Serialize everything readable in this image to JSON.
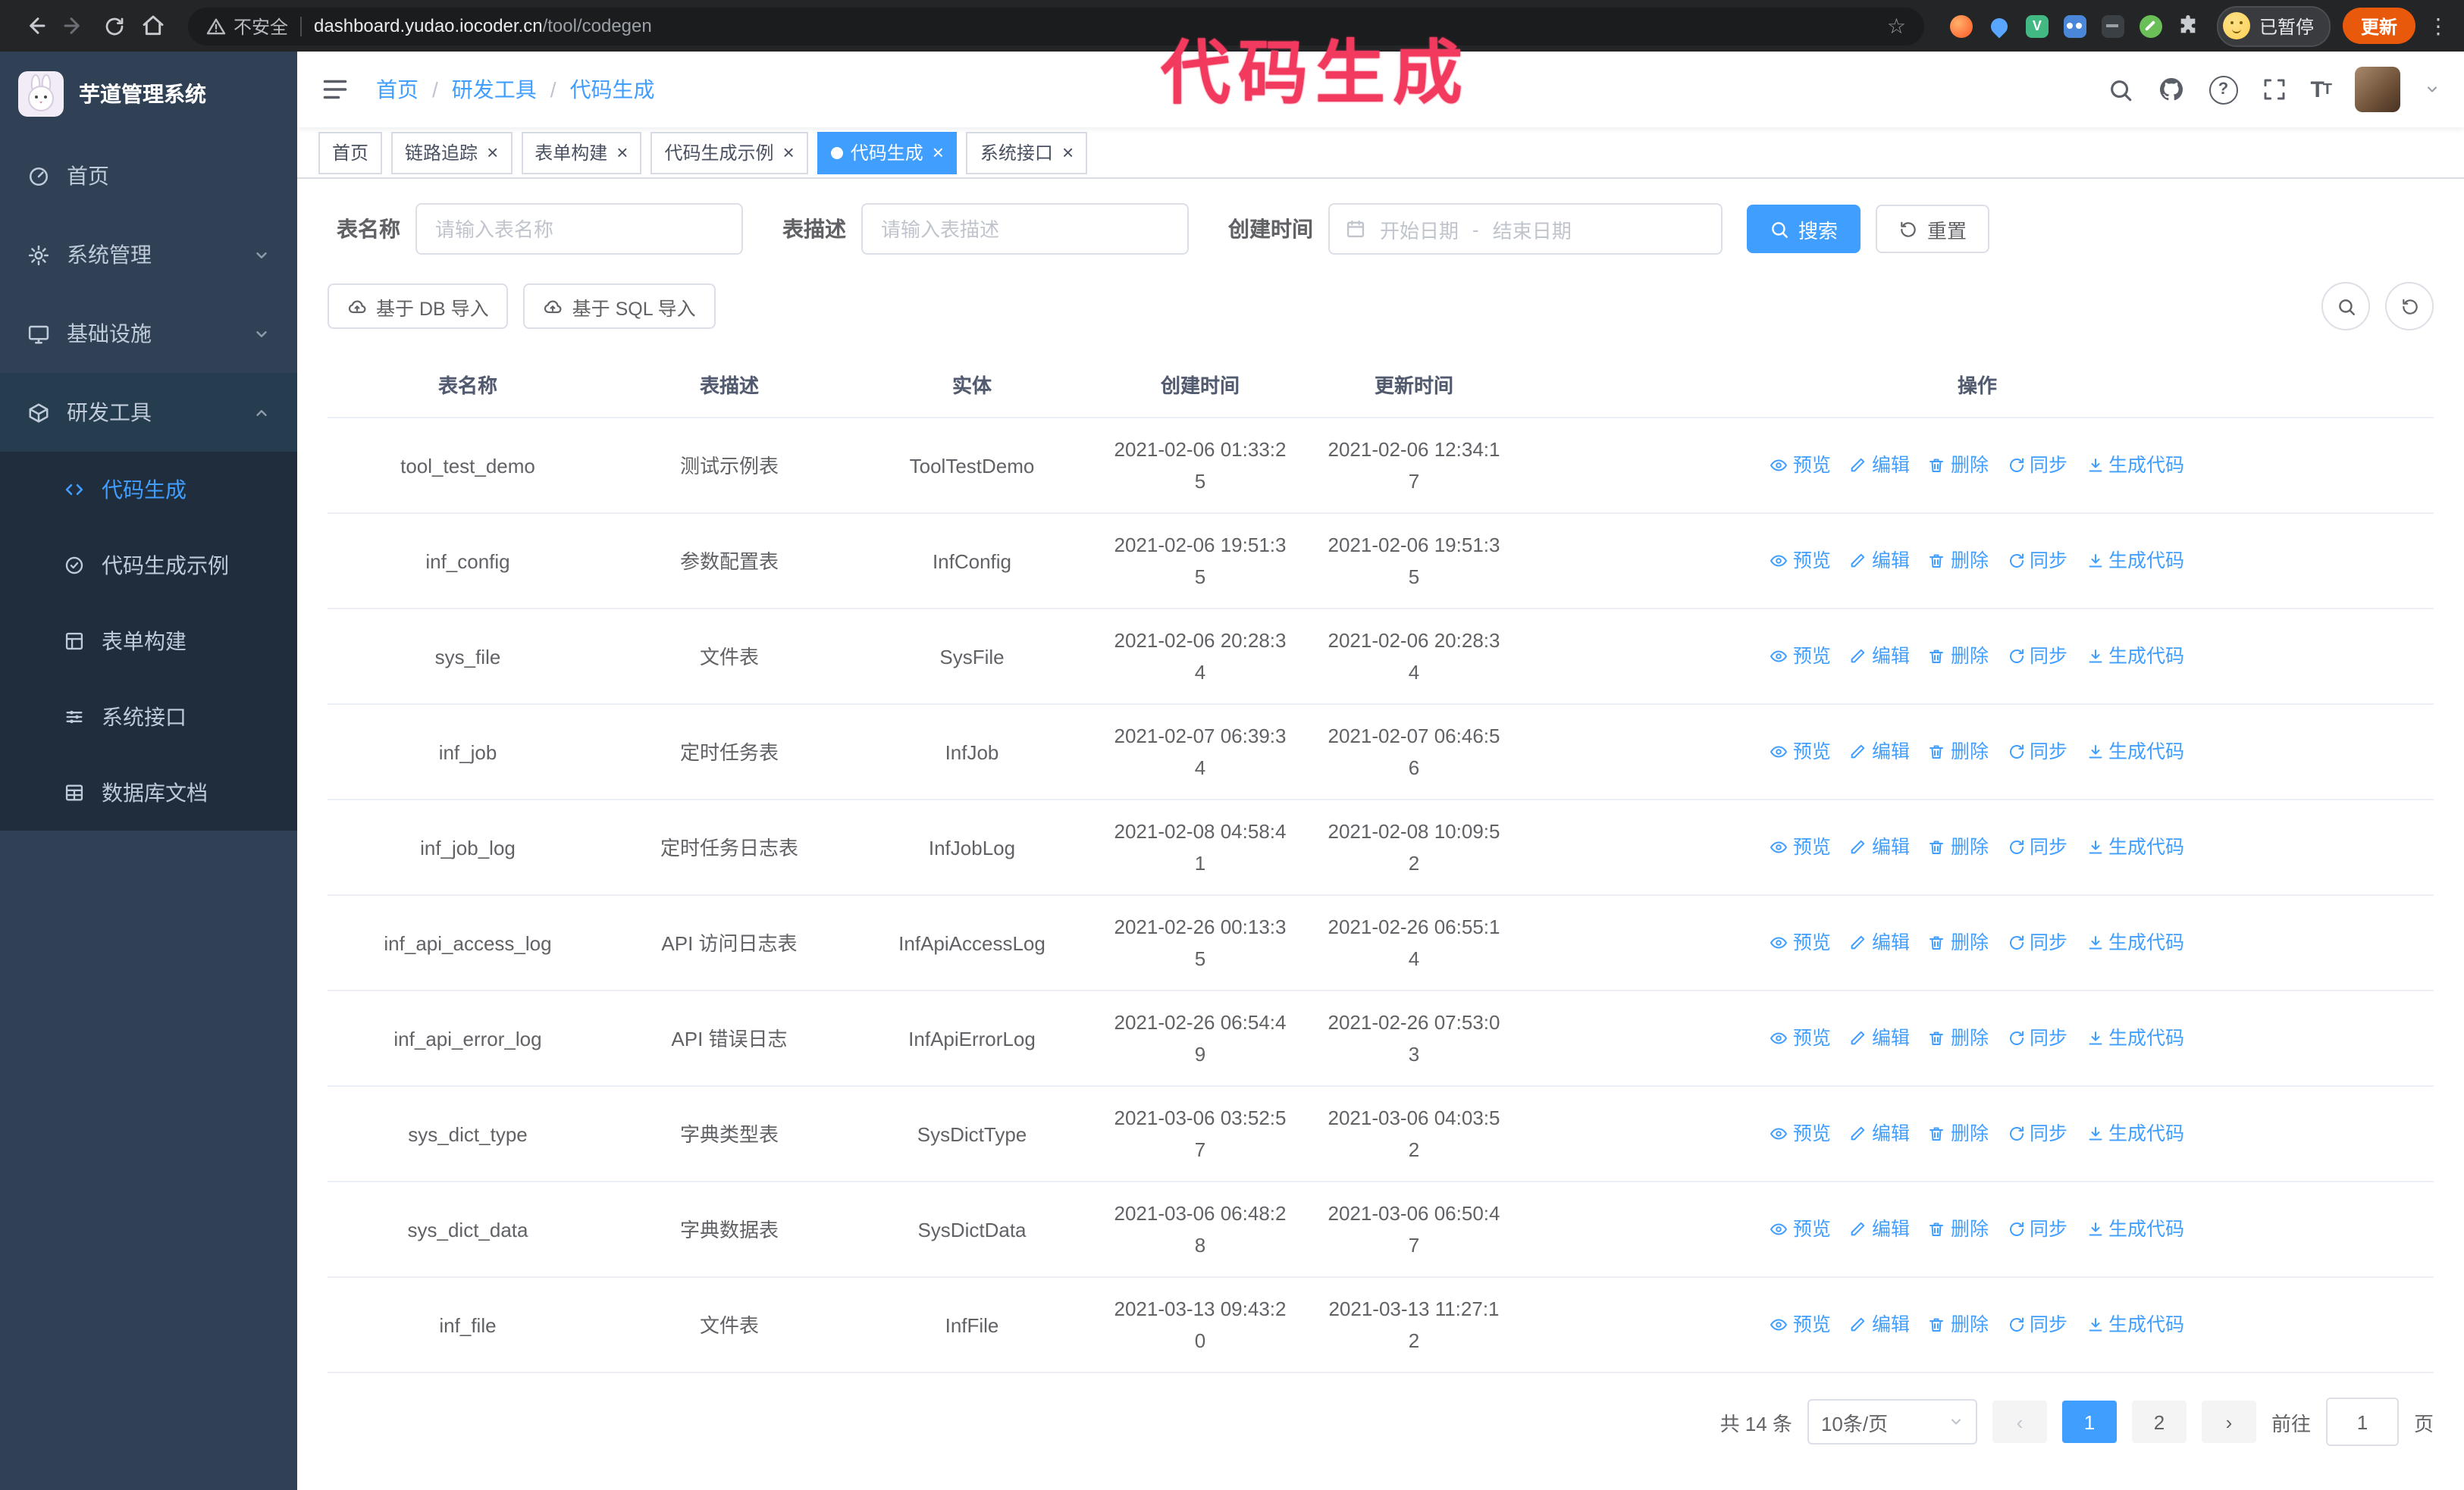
{
  "colors": {
    "accent": "#409eff",
    "annotation": "#f23a5f",
    "update_button": "#e8590c",
    "sidebar_bg": "#304156",
    "submenu_bg": "#1f2d3d"
  },
  "annotation": {
    "text": "代码生成"
  },
  "browser": {
    "nav_icons": [
      "back-icon",
      "forward-icon",
      "reload-icon",
      "home-icon"
    ],
    "security_label": "不安全",
    "url_domain": "dashboard.yudao.iocoder.cn",
    "url_path": "/tool/codegen",
    "extension_icons": [
      "fox-extension-icon",
      "drop-extension-icon",
      "vue-extension-icon",
      "users-extension-icon",
      "dark-extension-icon",
      "leaf-extension-icon",
      "puzzle-icon"
    ],
    "profile_badge": "已暂停",
    "update_label": "更新"
  },
  "sidebar": {
    "logo_title": "芋道管理系统",
    "items": [
      {
        "label": "首页",
        "icon": "dashboard-icon",
        "expandable": false
      },
      {
        "label": "系统管理",
        "icon": "gear-icon",
        "expandable": true
      },
      {
        "label": "基础设施",
        "icon": "monitor-icon",
        "expandable": true
      },
      {
        "label": "研发工具",
        "icon": "toolbox-icon",
        "expandable": true,
        "expanded": true
      }
    ],
    "submenu": [
      {
        "label": "代码生成",
        "icon": "code-icon",
        "active": true
      },
      {
        "label": "代码生成示例",
        "icon": "badge-check-icon",
        "active": false
      },
      {
        "label": "表单构建",
        "icon": "form-icon",
        "active": false
      },
      {
        "label": "系统接口",
        "icon": "sliders-icon",
        "active": false
      },
      {
        "label": "数据库文档",
        "icon": "table-icon",
        "active": false
      }
    ]
  },
  "header": {
    "breadcrumb": [
      "首页",
      "研发工具",
      "代码生成"
    ],
    "separator": "/"
  },
  "tabs": [
    {
      "label": "首页",
      "closable": false,
      "active": false
    },
    {
      "label": "链路追踪",
      "closable": true,
      "active": false
    },
    {
      "label": "表单构建",
      "closable": true,
      "active": false
    },
    {
      "label": "代码生成示例",
      "closable": true,
      "active": false
    },
    {
      "label": "代码生成",
      "closable": true,
      "active": true
    },
    {
      "label": "系统接口",
      "closable": true,
      "active": false
    }
  ],
  "filters": {
    "table_name_label": "表名称",
    "table_name_placeholder": "请输入表名称",
    "table_desc_label": "表描述",
    "table_desc_placeholder": "请输入表描述",
    "create_time_label": "创建时间",
    "date_start_placeholder": "开始日期",
    "date_separator": "-",
    "date_end_placeholder": "结束日期",
    "search_label": "搜索",
    "reset_label": "重置"
  },
  "toolbar": {
    "import_db_label": "基于 DB 导入",
    "import_sql_label": "基于 SQL 导入",
    "icons": [
      "search-icon",
      "refresh-icon"
    ]
  },
  "table": {
    "columns": [
      "表名称",
      "表描述",
      "实体",
      "创建时间",
      "更新时间",
      "操作"
    ],
    "actions": [
      {
        "label": "预览",
        "icon": "eye-icon"
      },
      {
        "label": "编辑",
        "icon": "edit-icon"
      },
      {
        "label": "删除",
        "icon": "trash-icon"
      },
      {
        "label": "同步",
        "icon": "sync-icon"
      },
      {
        "label": "生成代码",
        "icon": "download-icon"
      }
    ],
    "rows": [
      {
        "name": "tool_test_demo",
        "desc": "测试示例表",
        "entity": "ToolTestDemo",
        "created": "2021-02-06 01:33:25",
        "updated": "2021-02-06 12:34:17"
      },
      {
        "name": "inf_config",
        "desc": "参数配置表",
        "entity": "InfConfig",
        "created": "2021-02-06 19:51:35",
        "updated": "2021-02-06 19:51:35"
      },
      {
        "name": "sys_file",
        "desc": "文件表",
        "entity": "SysFile",
        "created": "2021-02-06 20:28:34",
        "updated": "2021-02-06 20:28:34"
      },
      {
        "name": "inf_job",
        "desc": "定时任务表",
        "entity": "InfJob",
        "created": "2021-02-07 06:39:34",
        "updated": "2021-02-07 06:46:56"
      },
      {
        "name": "inf_job_log",
        "desc": "定时任务日志表",
        "entity": "InfJobLog",
        "created": "2021-02-08 04:58:41",
        "updated": "2021-02-08 10:09:52"
      },
      {
        "name": "inf_api_access_log",
        "desc": "API 访问日志表",
        "entity": "InfApiAccessLog",
        "created": "2021-02-26 00:13:35",
        "updated": "2021-02-26 06:55:14"
      },
      {
        "name": "inf_api_error_log",
        "desc": "API 错误日志",
        "entity": "InfApiErrorLog",
        "created": "2021-02-26 06:54:49",
        "updated": "2021-02-26 07:53:03"
      },
      {
        "name": "sys_dict_type",
        "desc": "字典类型表",
        "entity": "SysDictType",
        "created": "2021-03-06 03:52:57",
        "updated": "2021-03-06 04:03:52"
      },
      {
        "name": "sys_dict_data",
        "desc": "字典数据表",
        "entity": "SysDictData",
        "created": "2021-03-06 06:48:28",
        "updated": "2021-03-06 06:50:47"
      },
      {
        "name": "inf_file",
        "desc": "文件表",
        "entity": "InfFile",
        "created": "2021-03-13 09:43:20",
        "updated": "2021-03-13 11:27:12"
      }
    ]
  },
  "pagination": {
    "total_label": "共 14 条",
    "page_size_label": "10条/页",
    "pages": [
      "1",
      "2"
    ],
    "current_page": "1",
    "goto_label": "前往",
    "goto_value": "1",
    "goto_unit": "页"
  }
}
